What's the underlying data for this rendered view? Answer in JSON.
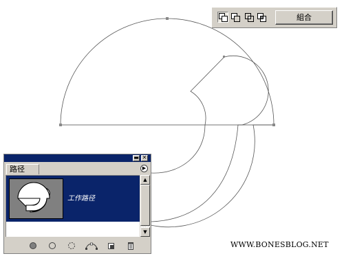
{
  "path_ops_toolbar": {
    "buttons": [
      {
        "name": "add-to-shape-area-icon",
        "active": true
      },
      {
        "name": "subtract-from-shape-area-icon",
        "active": false
      },
      {
        "name": "intersect-shape-areas-icon",
        "active": false
      },
      {
        "name": "exclude-overlapping-areas-icon",
        "active": false
      }
    ],
    "combine_label": "組合"
  },
  "paths_palette": {
    "tab_label": "路径",
    "title_buttons": [
      "minimize-icon",
      "close-icon"
    ],
    "items": [
      {
        "name": "工作路径",
        "selected": true
      }
    ],
    "footer_icons": [
      "fill-path-icon",
      "stroke-path-icon",
      "load-path-as-selection-icon",
      "make-work-path-icon",
      "new-path-icon",
      "delete-path-icon"
    ]
  },
  "watermark": "WWW.BONESBLOG.NET"
}
